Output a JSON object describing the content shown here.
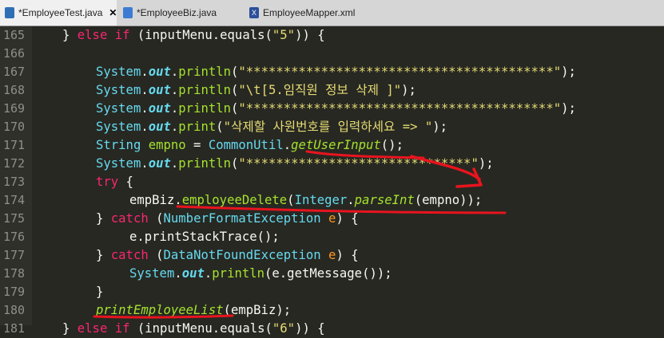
{
  "tabs": [
    {
      "label": "*EmployeeTest.java",
      "close": "✕",
      "active": true
    },
    {
      "label": "*EmployeeBiz.java",
      "active": false
    },
    {
      "label": "EmployeeMapper.xml",
      "icon_text": "X",
      "active": false
    }
  ],
  "line_numbers": [
    "165",
    "166",
    "167",
    "168",
    "169",
    "170",
    "171",
    "172",
    "173",
    "174",
    "175",
    "176",
    "177",
    "178",
    "179",
    "180",
    "181"
  ],
  "code": {
    "l165": {
      "a": "} ",
      "b": "else if",
      "c": " (inputMenu.equals(",
      "d": "\"5\"",
      "e": ")) {"
    },
    "l167": {
      "a": "System",
      "b": ".",
      "c": "out",
      "d": ".",
      "e": "println",
      "f": "(",
      "g": "\"*****************************************\"",
      "h": ");"
    },
    "l168": {
      "a": "System",
      "b": ".",
      "c": "out",
      "d": ".",
      "e": "println",
      "f": "(",
      "g": "\"\\t[5.임직원 정보 삭제 ]\"",
      "h": ");"
    },
    "l169": {
      "a": "System",
      "b": ".",
      "c": "out",
      "d": ".",
      "e": "println",
      "f": "(",
      "g": "\"*****************************************\"",
      "h": ");"
    },
    "l170": {
      "a": "System",
      "b": ".",
      "c": "out",
      "d": ".",
      "e": "print",
      "f": "(",
      "g": "\"삭제할 사원번호를 입력하세요 => \"",
      "h": ");"
    },
    "l171": {
      "a": "String ",
      "b": "empno",
      "c": " = ",
      "d": "CommonUtil",
      "e": ".",
      "f": "getUserInput",
      "g": "();"
    },
    "l172": {
      "a": "System",
      "b": ".",
      "c": "out",
      "d": ".",
      "e": "println",
      "f": "(",
      "g": "\"******************************\"",
      "h": ");"
    },
    "l173": {
      "a": "try",
      "b": " {"
    },
    "l174": {
      "a": "empBiz",
      "b": ".",
      "c": "employeeDelete",
      "d": "(",
      "e": "Integer",
      "f": ".",
      "g": "parseInt",
      "h": "(empno));"
    },
    "l175": {
      "a": "} ",
      "b": "catch",
      "c": " (",
      "d": "NumberFormatException",
      "e": " e",
      "f": ") {"
    },
    "l176": {
      "a": "e.printStackTrace();"
    },
    "l177": {
      "a": "} ",
      "b": "catch",
      "c": " (",
      "d": "DataNotFoundException",
      "e": " e",
      "f": ") {"
    },
    "l178": {
      "a": "System",
      "b": ".",
      "c": "out",
      "d": ".",
      "e": "println",
      "f": "(e.getMessage());"
    },
    "l179": {
      "a": "}"
    },
    "l180": {
      "a": "printEmployeeList",
      "b": "(empBiz);"
    },
    "l181": {
      "a": "} ",
      "b": "else if",
      "c": " (inputMenu.equals(",
      "d": "\"6\"",
      "e": ")) {"
    }
  },
  "colors": {
    "background": "#272822",
    "annotation": "#e8141e",
    "keyword": "#f92672",
    "type": "#66d9ef",
    "method": "#a6e22e",
    "string": "#e6db74"
  }
}
